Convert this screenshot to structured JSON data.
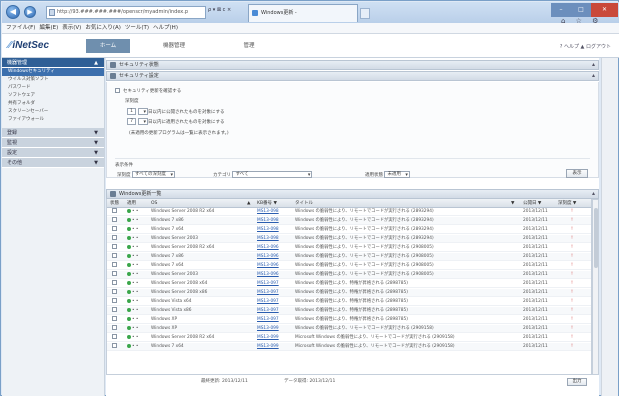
{
  "browser": {
    "address": "http://93.###.###.###/openscr/myadmin/index.p",
    "addr_tools": "ρ ▾ ⊠ c ×",
    "tab_title": "Windows更新 -",
    "win_min": "–",
    "win_max": "□",
    "win_close": "✕",
    "tools_icons": "⌂ ☆ ⚙",
    "menu": [
      "ファイル(F)",
      "編集(E)",
      "表示(V)",
      "お気に入り(A)",
      "ツール(T)",
      "ヘルプ(H)"
    ]
  },
  "app": {
    "logo": "iNetSec",
    "tabs": [
      "ホーム",
      "機器管理",
      "管理"
    ],
    "header_right": "? ヘルプ  ▲ ログアウト"
  },
  "sidebar": {
    "sections": [
      {
        "label": "機器管理",
        "chev": "▲",
        "state": "active"
      },
      {
        "label": "登録",
        "chev": "▼",
        "state": "collapsed"
      },
      {
        "label": "監視",
        "chev": "▼",
        "state": "collapsed"
      },
      {
        "label": "設定",
        "chev": "▼",
        "state": "collapsed"
      },
      {
        "label": "その他",
        "chev": "▼",
        "state": "collapsed"
      }
    ],
    "items": [
      "Windowsセキュリティ",
      "ウイルス対策ソフト",
      "パスワード",
      "ソフトウェア",
      "共有フォルダ",
      "スクリーンセーバー",
      "ファイアウォール"
    ]
  },
  "panels": {
    "top1": "セキュリティ状態",
    "top2": "セキュリティ設定",
    "table": "Windows更新一覧"
  },
  "settings": {
    "line1": "セキュリティ更新を確認する",
    "line2": "深刻度",
    "row_a_num": "1",
    "row_a_text": "日以内に公開されたものを対象にする",
    "row_b_num": "7",
    "row_b_text": "日以内に適用されたものを対象にする",
    "note": "(未適用の更新プログラムは一覧に表示されます。)",
    "filter_label": "表示条件",
    "f1_label": "深刻度",
    "f1_value": "すべての深刻度",
    "f2_label": "カテゴリ",
    "f2_value": "すべて",
    "f3_label": "適用状態",
    "f3_value": "未適用",
    "go": "表示"
  },
  "table": {
    "headers": [
      "状態",
      "適用",
      "OS",
      "▲",
      "KB番号 ▼",
      "タイトル",
      "▼",
      "公開日 ▼",
      "深刻度 ▼"
    ],
    "rows": [
      {
        "os": "Windows Server 2008 R2 x64",
        "kb": "MS13-098",
        "title": "Windows の脆弱性により、リモートでコードが実行される (2893294)",
        "date": "2013/12/11",
        "risk": "!"
      },
      {
        "os": "Windows 7 x86",
        "kb": "MS13-098",
        "title": "Windows の脆弱性により、リモートでコードが実行される (2893294)",
        "date": "2013/12/11",
        "risk": "!"
      },
      {
        "os": "Windows 7 x64",
        "kb": "MS13-098",
        "title": "Windows の脆弱性により、リモートでコードが実行される (2893294)",
        "date": "2013/12/11",
        "risk": "!"
      },
      {
        "os": "Windows Server 2003",
        "kb": "MS13-098",
        "title": "Windows の脆弱性により、リモートでコードが実行される (2893294)",
        "date": "2013/12/11",
        "risk": "!"
      },
      {
        "os": "Windows Server 2008 R2 x64",
        "kb": "MS13-096",
        "title": "Windows の脆弱性により、リモートでコードが実行される (2908005)",
        "date": "2013/12/11",
        "risk": "!"
      },
      {
        "os": "Windows 7 x86",
        "kb": "MS13-096",
        "title": "Windows の脆弱性により、リモートでコードが実行される (2908005)",
        "date": "2013/12/11",
        "risk": "!"
      },
      {
        "os": "Windows 7 x64",
        "kb": "MS13-096",
        "title": "Windows の脆弱性により、リモートでコードが実行される (2908005)",
        "date": "2013/12/11",
        "risk": "!"
      },
      {
        "os": "Windows Server 2003",
        "kb": "MS13-096",
        "title": "Windows の脆弱性により、リモートでコードが実行される (2908005)",
        "date": "2013/12/11",
        "risk": "!"
      },
      {
        "os": "Windows Server 2008 x64",
        "kb": "MS13-097",
        "title": "Windows の脆弱性により、特権が昇格される (2898785)",
        "date": "2013/12/11",
        "risk": "!"
      },
      {
        "os": "Windows Server 2008 x86",
        "kb": "MS13-097",
        "title": "Windows の脆弱性により、特権が昇格される (2898785)",
        "date": "2013/12/11",
        "risk": "!"
      },
      {
        "os": "Windows Vista x64",
        "kb": "MS13-097",
        "title": "Windows の脆弱性により、特権が昇格される (2898785)",
        "date": "2013/12/11",
        "risk": "!"
      },
      {
        "os": "Windows Vista x86",
        "kb": "MS13-097",
        "title": "Windows の脆弱性により、特権が昇格される (2898785)",
        "date": "2013/12/11",
        "risk": "!"
      },
      {
        "os": "Windows XP",
        "kb": "MS13-097",
        "title": "Windows の脆弱性により、特権が昇格される (2898785)",
        "date": "2013/12/11",
        "risk": "!"
      },
      {
        "os": "Windows XP",
        "kb": "MS13-099",
        "title": "Windows の脆弱性により、リモートでコードが実行される (2909158)",
        "date": "2013/12/11",
        "risk": "!"
      },
      {
        "os": "Windows Server 2008 R2 x64",
        "kb": "MS13-099",
        "title": "Microsoft Windows の脆弱性により、リモートでコードが実行される (2909158)",
        "date": "2013/12/11",
        "risk": "!"
      },
      {
        "os": "Windows 7 x64",
        "kb": "MS13-099",
        "title": "Microsoft Windows の脆弱性により、リモートでコードが実行される (2909158)",
        "date": "2013/12/11",
        "risk": "!"
      }
    ]
  },
  "footer": {
    "left": "最終更新: 2013/12/11",
    "mid": "データ取得: 2013/12/11",
    "csv": "出力"
  }
}
